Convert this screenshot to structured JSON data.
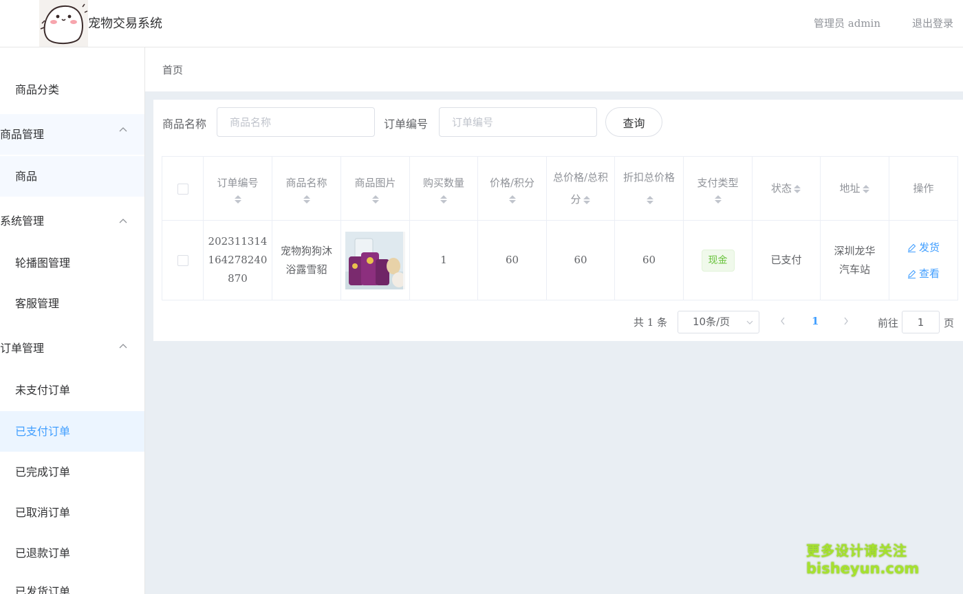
{
  "header": {
    "app_title": "宠物交易系统",
    "admin_label": "管理员 admin",
    "logout_label": "退出登录"
  },
  "sidebar": {
    "items": [
      {
        "label": "商品分类",
        "type": "sub"
      },
      {
        "label": "商品管理",
        "type": "group",
        "icon": "chevron-up-icon"
      },
      {
        "label": "商品",
        "type": "sub"
      },
      {
        "label": "系统管理",
        "type": "group",
        "icon": "chevron-up-icon"
      },
      {
        "label": "轮播图管理",
        "type": "sub"
      },
      {
        "label": "客服管理",
        "type": "sub"
      },
      {
        "label": "订单管理",
        "type": "group",
        "icon": "chevron-up-icon"
      },
      {
        "label": "未支付订单",
        "type": "sub"
      },
      {
        "label": "已支付订单",
        "type": "sub",
        "active": true
      },
      {
        "label": "已完成订单",
        "type": "sub"
      },
      {
        "label": "已取消订单",
        "type": "sub"
      },
      {
        "label": "已退款订单",
        "type": "sub"
      },
      {
        "label": "已发货订单",
        "type": "sub"
      }
    ]
  },
  "breadcrumb": {
    "home": "首页"
  },
  "search": {
    "product_label": "商品名称",
    "product_placeholder": "商品名称",
    "product_value": "",
    "order_label": "订单编号",
    "order_placeholder": "订单编号",
    "order_value": "",
    "query_label": "查询"
  },
  "table": {
    "headers": {
      "order_no": "订单编号",
      "product_name": "商品名称",
      "product_image": "商品图片",
      "quantity": "购买数量",
      "price": "价格/积分",
      "total": "总价格/总积分",
      "discount_total": "折扣总价格",
      "pay_type": "支付类型",
      "status": "状态",
      "address": "地址",
      "actions": "操作"
    },
    "rows": [
      {
        "order_no": "202311314164278240870",
        "product_name": "宠物狗狗沐浴露雪貂",
        "quantity": "1",
        "price": "60",
        "total": "60",
        "discount_total": "60",
        "pay_type": "现金",
        "status": "已支付",
        "address": "深圳龙华汽车站",
        "ship_label": "发货",
        "view_label": "查看"
      }
    ]
  },
  "pagination": {
    "total_label": "共 1 条",
    "page_size": "10条/页",
    "current_page": "1",
    "goto_label": "前往",
    "jump_value": "1",
    "page_suffix": "页"
  },
  "watermark": {
    "line1": "更多设计请关注",
    "line2": "bisheyun.com"
  },
  "colors": {
    "accent": "#409eff",
    "active_bg": "#ecf5ff",
    "cash_tag": "#67c23a",
    "page_bg": "#e9eef3"
  }
}
